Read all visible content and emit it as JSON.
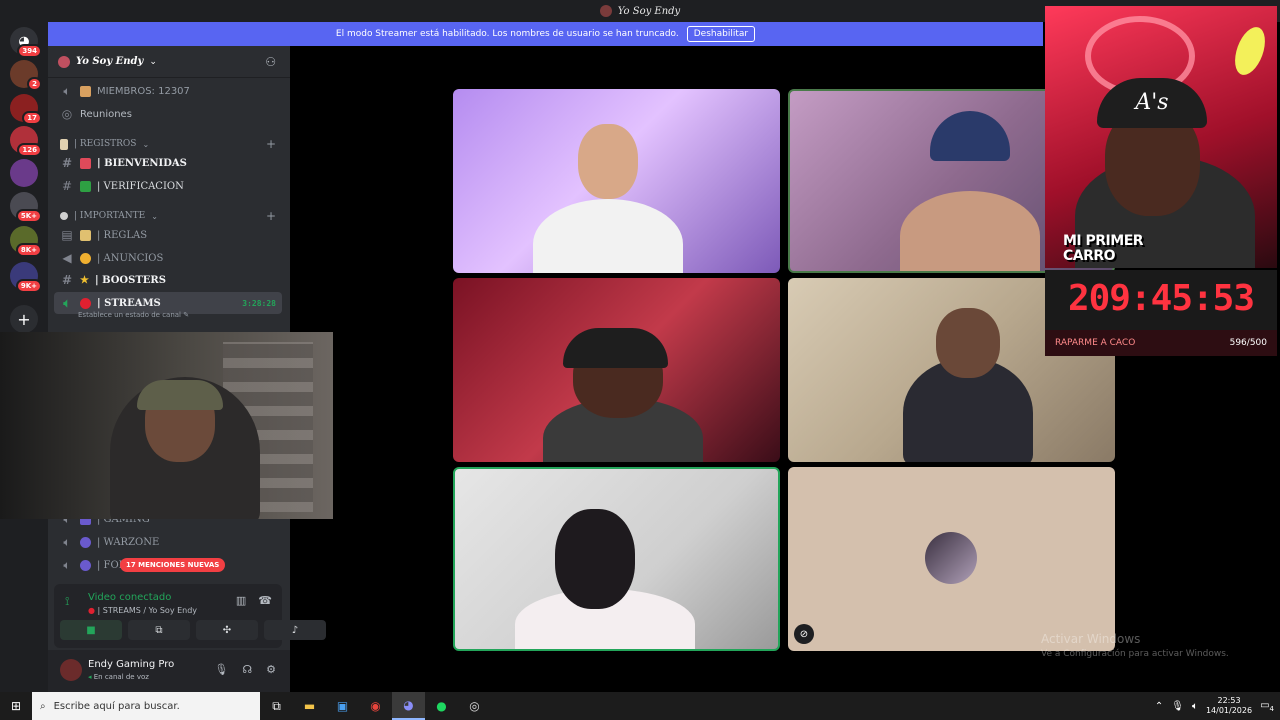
{
  "window": {
    "title": "Yo Soy Endy"
  },
  "banner": {
    "text": "El modo Streamer está habilitado. Los nombres de usuario se han truncado.",
    "button": "Deshabilitar"
  },
  "rail": {
    "badges": [
      "394",
      "2",
      "17",
      "126",
      "5K+",
      "8K+",
      "9K+"
    ]
  },
  "server": {
    "name": "Yo Soy Endy",
    "members_label": "MIEMBROS: 12307",
    "meetings_label": "Reuniones"
  },
  "categories": {
    "registros": "| REGISTROS",
    "importante": "| IMPORTANTE"
  },
  "channels": {
    "bienvenidas": "| BIENVENIDAS",
    "verificacion": "| VERIFICACION",
    "reglas": "| REGLAS",
    "anuncios": "| ANUNCIOS",
    "boosters": "| BOOSTERS",
    "streams": "| STREAMS",
    "streams_timer": "3:28:28",
    "streams_status": "Establece un estado de canal",
    "gaming": "| GAMING",
    "warzone": "| WARZONE",
    "fortnite": "| FOR"
  },
  "mentions_pill": "17 MENCIONES NUEVAS",
  "voice": {
    "title": "Video conectado",
    "channel": "| STREAMS / Yo Soy Endy"
  },
  "user": {
    "name": "Endy Gaming Pro",
    "status": "En canal de voz"
  },
  "overlay": {
    "label_line1": "MI PRIMER",
    "label_line2": "CARRO",
    "countdown": "209:45:53",
    "goal_label": "RAPARME A CACO",
    "goal_count": "596/500",
    "cap_text": "A's"
  },
  "watermark": {
    "line1": "Activar Windows",
    "line2": "Ve a Configuración para activar Windows."
  },
  "taskbar": {
    "search_placeholder": "Escribe aquí para buscar.",
    "time": "22:53",
    "date": "14/01/2026",
    "notifications": "4"
  },
  "colors": {
    "blurple": "#5865f2",
    "green": "#23a55a",
    "red": "#f23f43",
    "sidebar": "#2b2d31",
    "countdown": "#ff3340"
  },
  "icons": {
    "discord": "discord-icon",
    "speaker": "speaker-icon",
    "hash": "hash-icon",
    "signal": "signal-icon",
    "mic": "mic-icon",
    "headphones": "headphones-icon",
    "gear": "gear-icon"
  }
}
